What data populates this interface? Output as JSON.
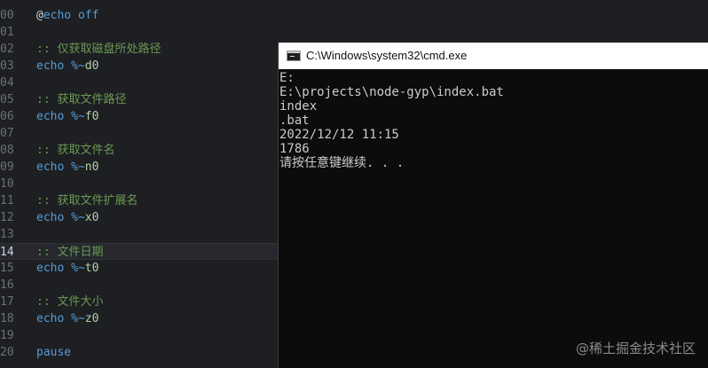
{
  "editor": {
    "lines": [
      {
        "num": "00",
        "segments": [
          {
            "cls": "c-at",
            "text": "@"
          },
          {
            "cls": "c-kw",
            "text": "echo"
          },
          {
            "cls": "c-kw",
            "text": " off"
          }
        ]
      },
      {
        "num": "01",
        "segments": []
      },
      {
        "num": "02",
        "segments": [
          {
            "cls": "c-comment",
            "text": ":: 仅获取磁盘所处路径"
          }
        ]
      },
      {
        "num": "03",
        "segments": [
          {
            "cls": "c-kw",
            "text": "echo "
          },
          {
            "cls": "c-var-mod",
            "text": "%~"
          },
          {
            "cls": "c-var",
            "text": "d0"
          }
        ]
      },
      {
        "num": "04",
        "segments": []
      },
      {
        "num": "05",
        "segments": [
          {
            "cls": "c-comment",
            "text": ":: 获取文件路径"
          }
        ]
      },
      {
        "num": "06",
        "segments": [
          {
            "cls": "c-kw",
            "text": "echo "
          },
          {
            "cls": "c-var-mod",
            "text": "%~"
          },
          {
            "cls": "c-var",
            "text": "f0"
          }
        ]
      },
      {
        "num": "07",
        "segments": []
      },
      {
        "num": "08",
        "segments": [
          {
            "cls": "c-comment",
            "text": ":: 获取文件名"
          }
        ]
      },
      {
        "num": "09",
        "segments": [
          {
            "cls": "c-kw",
            "text": "echo "
          },
          {
            "cls": "c-var-mod",
            "text": "%~"
          },
          {
            "cls": "c-var",
            "text": "n0"
          }
        ]
      },
      {
        "num": "10",
        "segments": []
      },
      {
        "num": "11",
        "segments": [
          {
            "cls": "c-comment",
            "text": ":: 获取文件扩展名"
          }
        ]
      },
      {
        "num": "12",
        "segments": [
          {
            "cls": "c-kw",
            "text": "echo "
          },
          {
            "cls": "c-var-mod",
            "text": "%~"
          },
          {
            "cls": "c-var",
            "text": "x0"
          }
        ]
      },
      {
        "num": "13",
        "segments": []
      },
      {
        "num": "14",
        "active": true,
        "segments": [
          {
            "cls": "c-comment",
            "text": ":: 文件日期"
          }
        ]
      },
      {
        "num": "15",
        "segments": [
          {
            "cls": "c-kw",
            "text": "echo "
          },
          {
            "cls": "c-var-mod",
            "text": "%~"
          },
          {
            "cls": "c-var",
            "text": "t0"
          }
        ]
      },
      {
        "num": "16",
        "segments": []
      },
      {
        "num": "17",
        "segments": [
          {
            "cls": "c-comment",
            "text": ":: 文件大小"
          }
        ]
      },
      {
        "num": "18",
        "segments": [
          {
            "cls": "c-kw",
            "text": "echo "
          },
          {
            "cls": "c-var-mod",
            "text": "%~"
          },
          {
            "cls": "c-var",
            "text": "z0"
          }
        ]
      },
      {
        "num": "19",
        "segments": []
      },
      {
        "num": "20",
        "segments": [
          {
            "cls": "c-kw",
            "text": "pause"
          }
        ]
      }
    ]
  },
  "cmd": {
    "title": "C:\\Windows\\system32\\cmd.exe",
    "output": [
      "E:",
      "E:\\projects\\node-gyp\\index.bat",
      "index",
      ".bat",
      "2022/12/12 11:15",
      "1786",
      "请按任意键继续. . ."
    ]
  },
  "watermark": "@稀土掘金技术社区",
  "colors": {
    "editor_bg": "#1e1f22",
    "keyword": "#569cd6",
    "comment": "#6a9955",
    "console_bg": "#0c0c0c",
    "console_text": "#cccccc"
  }
}
